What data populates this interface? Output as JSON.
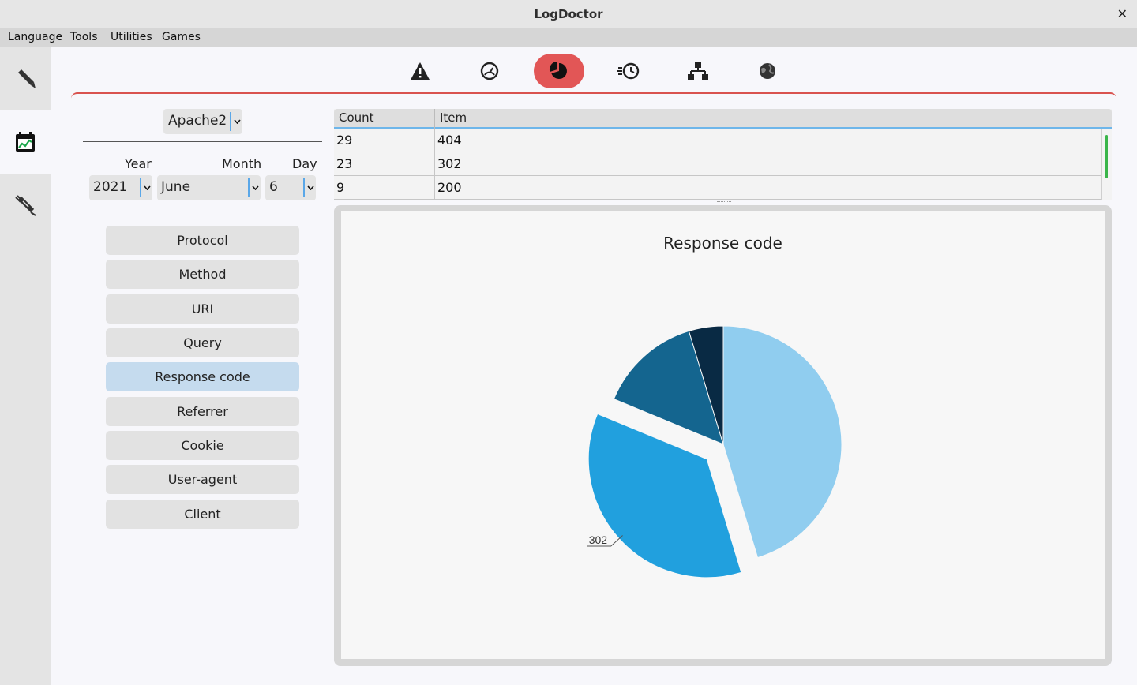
{
  "window": {
    "title": "LogDoctor",
    "close_symbol": "✕"
  },
  "menu": [
    "Language",
    "Tools",
    "Utilities",
    "Games"
  ],
  "sidebar": [
    {
      "icon": "pencil-icon"
    },
    {
      "icon": "calendar-chart-icon",
      "active": true
    },
    {
      "icon": "syringe-icon"
    }
  ],
  "toolbar": [
    {
      "icon": "warning-icon"
    },
    {
      "icon": "speed-gauge-icon"
    },
    {
      "icon": "pie-chart-icon",
      "active": true
    },
    {
      "icon": "fast-clock-icon"
    },
    {
      "icon": "hierarchy-icon"
    },
    {
      "icon": "globe-icon"
    }
  ],
  "controls": {
    "webserver": "Apache2",
    "year_label": "Year",
    "month_label": "Month",
    "day_label": "Day",
    "year": "2021",
    "month": "June",
    "day": "6"
  },
  "fields": [
    "Protocol",
    "Method",
    "URI",
    "Query",
    "Response code",
    "Referrer",
    "Cookie",
    "User-agent",
    "Client"
  ],
  "active_field": "Response code",
  "table": {
    "headers": [
      "Count",
      "Item"
    ],
    "rows": [
      [
        "29",
        "404"
      ],
      [
        "23",
        "302"
      ],
      [
        "9",
        "200"
      ]
    ]
  },
  "colors": {
    "accent": "#e25656",
    "selected": "#c5dbee",
    "slices": [
      "#90cdef",
      "#21a0de",
      "#14658f",
      "#092a44"
    ]
  },
  "chart_data": {
    "type": "pie",
    "title": "Response code",
    "categories": [
      "404",
      "302",
      "200",
      ""
    ],
    "values": [
      29,
      23,
      9,
      3
    ],
    "exploded": "302",
    "labels_shown": [
      "302"
    ]
  }
}
